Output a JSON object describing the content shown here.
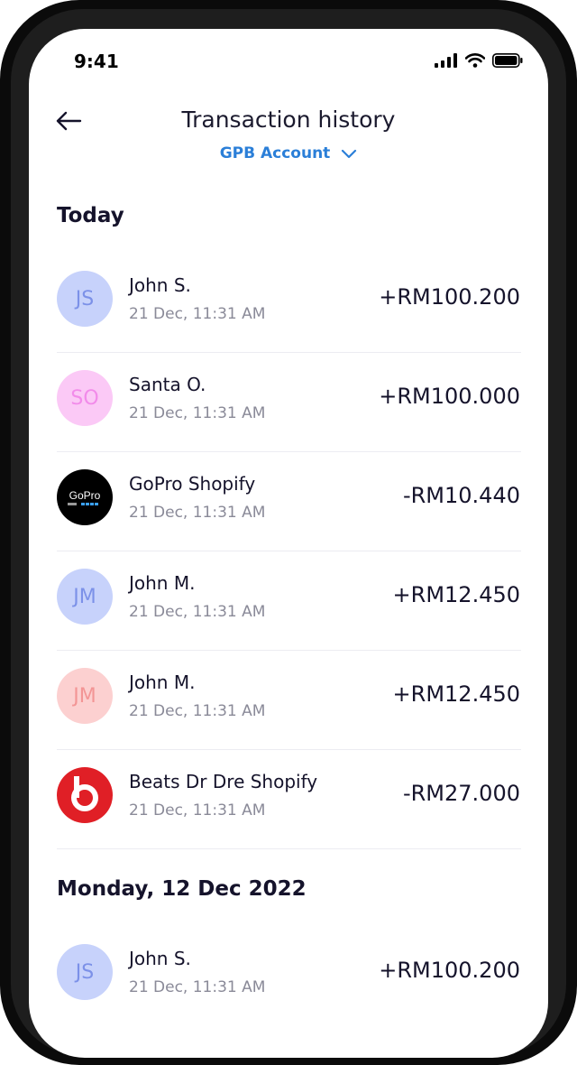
{
  "status_bar": {
    "time": "9:41"
  },
  "header": {
    "title": "Transaction history",
    "account": "GPB Account"
  },
  "sections": [
    {
      "title": "Today",
      "transactions": [
        {
          "initials": "JS",
          "name": "John S.",
          "date": "21 Dec, 11:31 AM",
          "amount": "+RM100.200",
          "avatar_bg": "#c7d2fb",
          "avatar_fg": "#7c91e8"
        },
        {
          "initials": "SO",
          "name": "Santa O.",
          "date": "21 Dec, 11:31 AM",
          "amount": "+RM100.000",
          "avatar_bg": "#fbc9f6",
          "avatar_fg": "#f28bea"
        },
        {
          "logo": "gopro-logo",
          "logo_text": "GoPro",
          "name": "GoPro Shopify",
          "date": "21 Dec, 11:31 AM",
          "amount": "-RM10.440"
        },
        {
          "initials": "JM",
          "name": "John M.",
          "date": "21 Dec, 11:31 AM",
          "amount": "+RM12.450",
          "avatar_bg": "#c7d2fb",
          "avatar_fg": "#7c91e8"
        },
        {
          "initials": "JM",
          "name": "John M.",
          "date": "21 Dec, 11:31 AM",
          "amount": "+RM12.450",
          "avatar_bg": "#fcd0d0",
          "avatar_fg": "#f39595"
        },
        {
          "logo": "beats-logo",
          "name": "Beats Dr Dre Shopify",
          "date": "21 Dec, 11:31 AM",
          "amount": "-RM27.000"
        }
      ]
    },
    {
      "title": "Monday, 12 Dec 2022",
      "transactions": [
        {
          "initials": "JS",
          "name": "John S.",
          "date": "21 Dec, 11:31 AM",
          "amount": "+RM100.200",
          "avatar_bg": "#c7d2fb",
          "avatar_fg": "#7c91e8"
        }
      ]
    }
  ],
  "colors": {
    "accent": "#2b7fd8",
    "text": "#15132b",
    "muted": "#8a8a98",
    "beats_red": "#e01f26"
  }
}
